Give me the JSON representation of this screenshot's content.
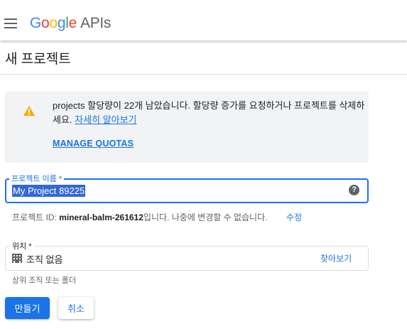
{
  "header": {
    "menu_icon": "hamburger-menu-icon",
    "brand": {
      "letters": [
        "G",
        "o",
        "o",
        "g",
        "l",
        "e"
      ],
      "suffix": "APIs"
    }
  },
  "page": {
    "title": "새 프로젝트"
  },
  "warning": {
    "icon": "warning-icon",
    "text": "projects 할당량이 22개 남았습니다. 할당량 증가를 요청하거나 프로젝트를 삭제하세요.",
    "link": "자세히 알아보기",
    "manage_label": "MANAGE QUOTAS"
  },
  "project_name": {
    "label": "프로젝트 이름 *",
    "value": "My Project 89225",
    "help_icon": "help-icon"
  },
  "project_id": {
    "prefix": "프로젝트 ID: ",
    "id": "mineral-balm-261612",
    "suffix": "입니다. 나중에 변경할 수 없습니다.",
    "edit_label": "수정"
  },
  "location": {
    "label": "위치 *",
    "icon": "organization-icon",
    "value": "조직 없음",
    "browse_label": "찾아보기",
    "hint": "상위 조직 또는 폴더"
  },
  "actions": {
    "create_label": "만들기",
    "cancel_label": "취소"
  },
  "colors": {
    "accent": "#1a73e8",
    "warning": "#f9ab00",
    "panel": "#f1f3f4"
  }
}
